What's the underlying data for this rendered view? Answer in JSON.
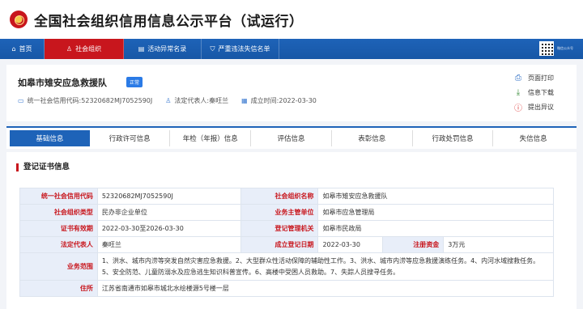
{
  "site": {
    "title": "全国社会组织信用信息公示平台（试运行）"
  },
  "nav": {
    "items": [
      {
        "label": "首页",
        "icon": "home-icon"
      },
      {
        "label": "社会组织",
        "icon": "user-icon"
      },
      {
        "label": "活动异常名录",
        "icon": "list-icon"
      },
      {
        "label": "严重违法失信名单",
        "icon": "shield-icon"
      }
    ],
    "qr_caption": "微信公众号"
  },
  "org": {
    "name": "如皋市雉安应急救援队",
    "status": "正常",
    "credit_code_label": "统一社会信用代码:",
    "credit_code": "52320682MJ7052590J",
    "legal_rep_label": "法定代表人:",
    "legal_rep": "秦旺兰",
    "established_label": "成立时间:",
    "established": "2022-03-30"
  },
  "actions": {
    "print": "页面打印",
    "download": "信息下载",
    "objection": "提出异议"
  },
  "tabs": [
    "基础信息",
    "行政许可信息",
    "年检（年报）信息",
    "评估信息",
    "表彰信息",
    "行政处罚信息",
    "失信信息"
  ],
  "section": {
    "title": "登记证书信息"
  },
  "table": {
    "credit_code_k": "统一社会信用代码",
    "credit_code_v": "52320682MJ7052590J",
    "org_name_k": "社会组织名称",
    "org_name_v": "如皋市雉安应急救援队",
    "org_type_k": "社会组织类型",
    "org_type_v": "民办非企业单位",
    "supervisor_k": "业务主管单位",
    "supervisor_v": "如皋市应急管理局",
    "validity_k": "证书有效期",
    "validity_v": "2022-03-30至2026-03-30",
    "registrar_k": "登记管理机关",
    "registrar_v": "如皋市民政局",
    "legal_rep_k": "法定代表人",
    "legal_rep_v": "秦旺兰",
    "established_k": "成立登记日期",
    "established_v": "2022-03-30",
    "capital_k": "注册资金",
    "capital_v": "3万元",
    "scope_k": "业务范围",
    "scope_v": "1、洪水、城市内涝等突发自然灾害应急救援。2、大型群众性活动保障的辅助性工作。3、洪水、城市内涝等应急救援演练任务。4、内河水域搜救任务。5、安全防范、儿童防溺水及应急逃生知识科普宣传。6、高楼中受困人员救助。7、失踪人员搜寻任务。",
    "address_k": "住所",
    "address_v": "江苏省南通市如皋市城北水绘楼源5号楼一层"
  }
}
